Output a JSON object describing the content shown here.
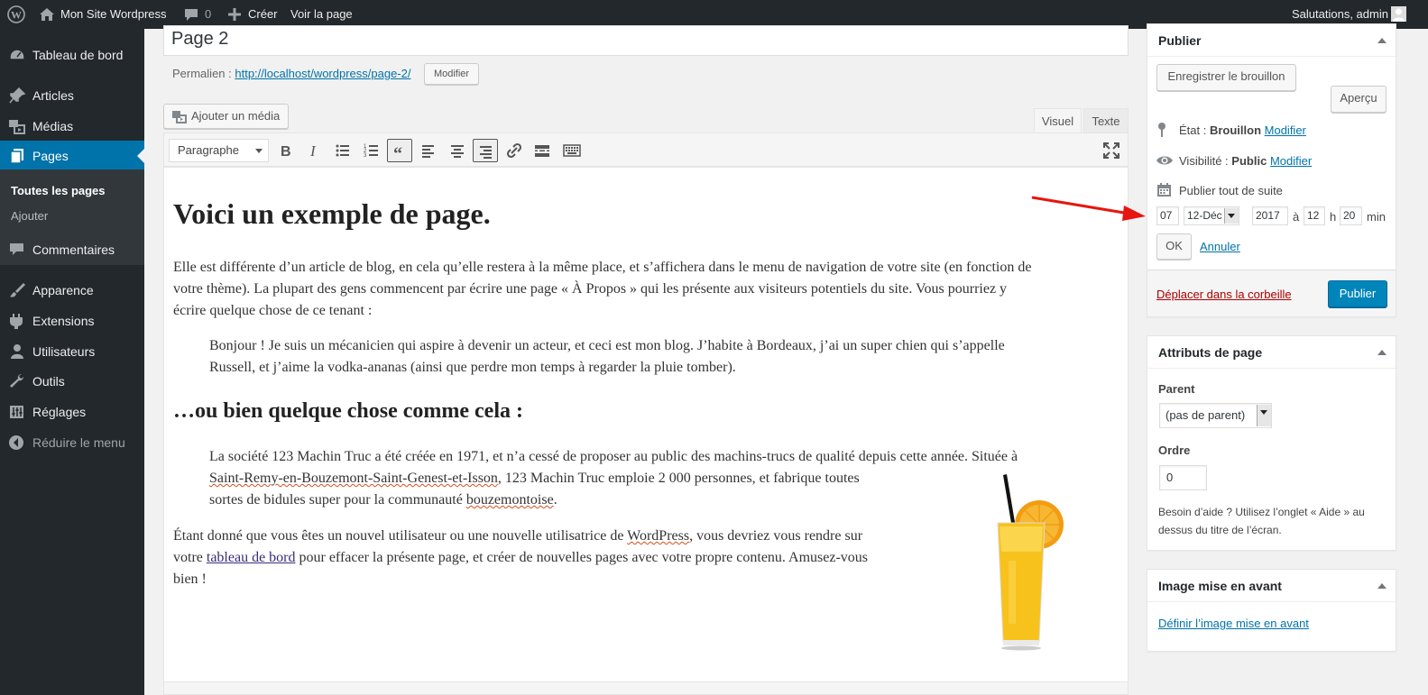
{
  "adminbar": {
    "site_name": "Mon Site Wordpress",
    "comments_count": "0",
    "new_label": "Créer",
    "view_label": "Voir la page",
    "greeting": "Salutations, admin"
  },
  "menu": {
    "items": [
      {
        "label": "Tableau de bord",
        "icon": "dashboard-icon"
      },
      {
        "label": "Articles",
        "icon": "pin-icon"
      },
      {
        "label": "Médias",
        "icon": "media-icon"
      },
      {
        "label": "Pages",
        "icon": "pages-icon"
      },
      {
        "label": "Commentaires",
        "icon": "comments-icon"
      },
      {
        "label": "Apparence",
        "icon": "brush-icon"
      },
      {
        "label": "Extensions",
        "icon": "plugin-icon"
      },
      {
        "label": "Utilisateurs",
        "icon": "users-icon"
      },
      {
        "label": "Outils",
        "icon": "wrench-icon"
      },
      {
        "label": "Réglages",
        "icon": "settings-icon"
      },
      {
        "label": "Réduire le menu",
        "icon": "collapse-icon"
      }
    ],
    "submenu": [
      "Toutes les pages",
      "Ajouter"
    ]
  },
  "editor": {
    "title": "Page 2",
    "permalink_label": "Permalien :",
    "permalink_url": "http://localhost/wordpress/page-2/",
    "permalink_edit": "Modifier",
    "add_media": "Ajouter un média",
    "tab_visual": "Visuel",
    "tab_text": "Texte",
    "format_select": "Paragraphe",
    "toolbar_buttons": [
      "bold",
      "italic",
      "bullet-list",
      "numbered-list",
      "blockquote",
      "align-left",
      "align-center",
      "align-right",
      "link",
      "read-more",
      "toolbar-toggle"
    ]
  },
  "content": {
    "h1": "Voici un exemple de page.",
    "p1_l1": "Elle est différente d’un article de blog, en cela qu’elle restera à la même place, et s’affichera dans le menu de navigation de votre site (en fonction de",
    "p1_l2": "votre thème). La plupart des gens commencent par écrire une page « À Propos » qui les présente aux visiteurs potentiels du site. Vous pourriez y",
    "p1_l3": "écrire quelque chose de ce tenant :",
    "q1_l1": "Bonjour ! Je suis un mécanicien qui aspire à devenir un acteur, et ceci est mon blog. J’habite à Bordeaux, j’ai un super chien qui s’appelle",
    "q1_l2": "Russell, et j’aime la vodka-ananas (ainsi que perdre mon temps à regarder la pluie tomber).",
    "h2": "…ou bien quelque chose comme cela :",
    "q2_l1": "La société 123 Machin Truc a été créée en 1971, et n’a cessé de proposer au public des machins-trucs de qualité depuis cette année. Située à",
    "q2_l2a": "Saint-Remy-en-Bouzemont-Saint-Genest-et-Isson",
    "q2_l2b": ", 123 Machin Truc emploie 2 000 personnes, et fabrique toutes",
    "q2_l3a": "sortes de bidules super pour la communauté ",
    "q2_l3b": "bouzemontoise",
    "q2_l3c": ".",
    "p2_l1a": "Étant donné que vous êtes un nouvel utilisateur ou une nouvelle utilisatrice de ",
    "p2_l1b": "WordPress",
    "p2_l1c": ", vous devriez vous rendre sur",
    "p2_l2a": "votre ",
    "p2_l2b": "tableau de bord",
    "p2_l2c": " pour effacer la présente page, et créer de nouvelles pages avec votre propre contenu. Amusez-vous",
    "p2_l3": "bien !"
  },
  "publish": {
    "title": "Publier",
    "save_draft": "Enregistrer le brouillon",
    "preview": "Aperçu",
    "status_label": "État : ",
    "status_value": "Brouillon",
    "status_edit": "Modifier",
    "visibility_label": "Visibilité : ",
    "visibility_value": "Public",
    "visibility_edit": "Modifier",
    "schedule_label": "Publier tout de suite",
    "day": "07",
    "month": "12-Déc",
    "year": "2017",
    "at": "à",
    "hour": "12",
    "h": "h",
    "minute": "20",
    "min": "min",
    "ok": "OK",
    "cancel": "Annuler",
    "trash": "Déplacer dans la corbeille",
    "publish": "Publier"
  },
  "attributes": {
    "title": "Attributs de page",
    "parent_label": "Parent",
    "parent_value": "(pas de parent)",
    "order_label": "Ordre",
    "order_value": "0",
    "help_l1": "Besoin d’aide ? Utilisez l’onglet « Aide » au",
    "help_l2": "dessus du titre de l’écran."
  },
  "featured": {
    "title": "Image mise en avant",
    "link": "Définir l’image mise en avant"
  },
  "colors": {
    "admin_bar": "#23282d",
    "menu_current": "#0073aa",
    "publish_button": "#0085ba",
    "annotation_arrow": "#e8140f"
  }
}
